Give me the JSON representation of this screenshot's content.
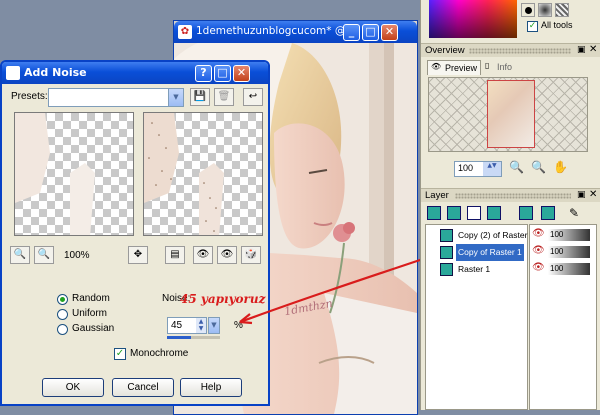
{
  "image_window": {
    "title": "1demethuzunblogcucom* @ ...",
    "annotation_text": "45 yapıyoruz",
    "tattoo_text": "1dmthzn"
  },
  "add_noise": {
    "title": "Add Noise",
    "presets_label": "Presets:",
    "presets_value": "",
    "zoom": "100%",
    "noise_label": "Noise:",
    "noise_value": "45",
    "percent_symbol": "%",
    "options": [
      {
        "label": "Random",
        "selected": true
      },
      {
        "label": "Uniform",
        "selected": false
      },
      {
        "label": "Gaussian",
        "selected": false
      }
    ],
    "monochrome_label": "Monochrome",
    "monochrome_checked": true,
    "buttons": {
      "ok": "OK",
      "cancel": "Cancel",
      "help": "Help"
    }
  },
  "materials": {
    "all_tools_label": "All tools",
    "all_tools_checked": true
  },
  "overview": {
    "title": "Overview",
    "tabs": [
      "Preview",
      "Info"
    ],
    "zoom_value": "100"
  },
  "layers": {
    "title": "Layer",
    "items": [
      {
        "name": "Copy (2) of Raster",
        "opacity": "100",
        "selected": false
      },
      {
        "name": "Copy of Raster 1",
        "opacity": "100",
        "selected": true
      },
      {
        "name": "Raster 1",
        "opacity": "100",
        "selected": false
      }
    ]
  },
  "colors": {
    "title_bar": "#0a4fd8",
    "annotation": "#d91c1c",
    "selected_layer": "#316ac5"
  }
}
